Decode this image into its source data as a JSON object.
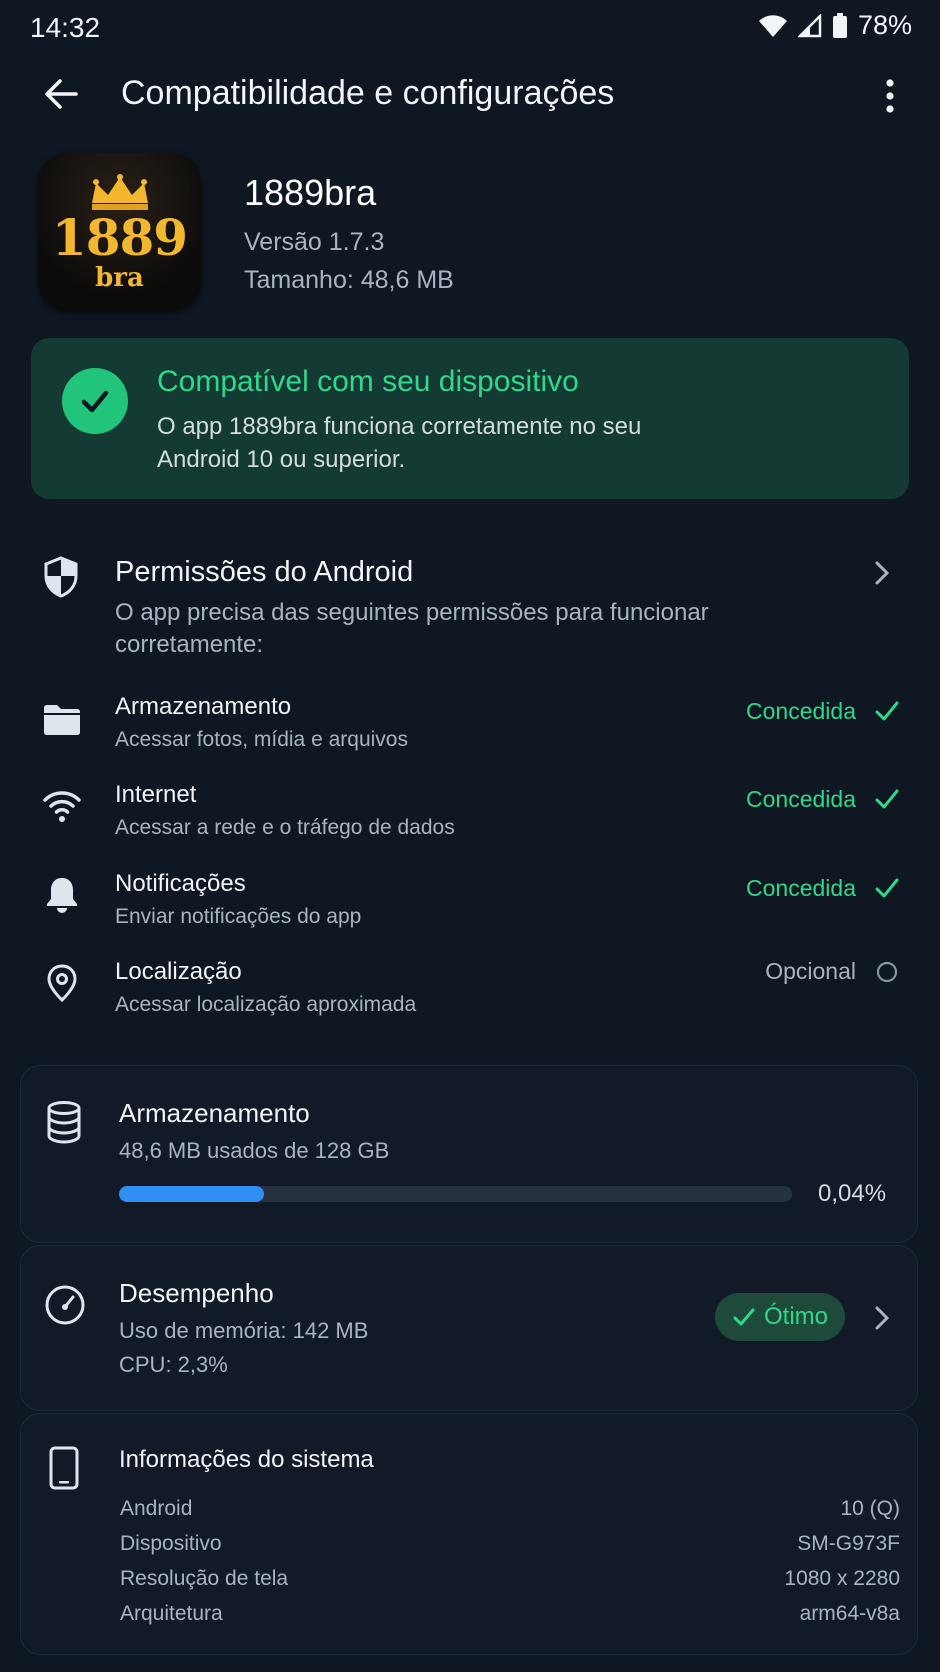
{
  "status_bar": {
    "time": "14:32",
    "battery": "78%"
  },
  "header": {
    "title": "Compatibilidade e configurações"
  },
  "app": {
    "icon_text_main": "1889",
    "icon_text_sub": "bra",
    "name": "1889bra",
    "version": "Versão 1.7.3",
    "size": "Tamanho: 48,6 MB"
  },
  "compat": {
    "title": "Compatível com seu dispositivo",
    "line1": "O app 1889bra funciona corretamente no seu",
    "line2": "Android 10 ou superior."
  },
  "permissions": {
    "title": "Permissões do Android",
    "desc_line1": "O app precisa das seguintes permissões para funcionar",
    "desc_line2": "corretamente:",
    "items": [
      {
        "name": "Armazenamento",
        "sub": "Acessar fotos, mídia e arquivos",
        "status": "Concedida",
        "icon": "folder-icon"
      },
      {
        "name": "Internet",
        "sub": "Acessar a rede e o tráfego de dados",
        "status": "Concedida",
        "icon": "wifi-icon"
      },
      {
        "name": "Notificações",
        "sub": "Enviar notificações do app",
        "status": "Concedida",
        "icon": "bell-icon"
      },
      {
        "name": "Localização",
        "sub": "Acessar localização aproximada",
        "status": "Opcional",
        "icon": "location-icon"
      }
    ]
  },
  "storage": {
    "title": "Armazenamento",
    "usage": "48,6 MB usados de 128 GB",
    "percent": "0,04%"
  },
  "performance": {
    "title": "Desempenho",
    "memory": "Uso de memória: 142 MB",
    "cpu": "CPU: 2,3%",
    "badge": "Ótimo"
  },
  "system": {
    "title": "Informações do sistema",
    "rows": [
      {
        "key": "Android",
        "value": "10 (Q)"
      },
      {
        "key": "Dispositivo",
        "value": "SM-G973F"
      },
      {
        "key": "Resolução de tela",
        "value": "1080 x 2280"
      },
      {
        "key": "Arquitetura",
        "value": "arm64-v8a"
      }
    ]
  },
  "colors": {
    "background": "#0f1722",
    "accent_green": "#2fd88a",
    "progress_blue": "#2f8ff5",
    "compat_card": "#133a33"
  }
}
